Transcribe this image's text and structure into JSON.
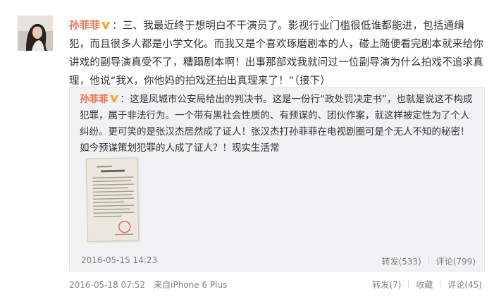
{
  "post": {
    "author": "孙菲菲",
    "badge_icon": "v-badge-icon",
    "text": "：三、我最近终于想明白不干演员了。影视行业门槛很低谁都能进，包括通缉犯，而且很多人都是小学文化。而我又是个喜欢琢磨剧本的人，碰上随便看完剧本就来给你讲戏的副导演真受不了，糟蹋剧本啊！出事那部戏我就问过一位副导演为什么拍戏不追求真理，他说“我X，你他妈的拍戏还拍出真理来了！”（接下）",
    "timestamp": "2016-05-18 07:52",
    "source": "来自iPhone 6 Plus",
    "repost_label": "转发(7)",
    "favorite_label": "收藏",
    "comment_label": "评论(45)"
  },
  "repost": {
    "author": "孙菲菲",
    "badge_icon": "v-badge-icon",
    "text": "：这是凤城市公安局给出的判决书。这是一份行“政处罚决定书”，也就是说这不构成犯罪，属于非法行为。一个带有黑社会性质的、有预谋的、团伙作案，就这样被定性为了个人纠纷。更可笑的是张汉杰居然成了证人！张汉杰打孙菲菲在电视剧圈可是个无人不知的秘密！如今预谋策划犯罪的人成了证人？！现实生活常",
    "timestamp": "2016-05-15 14:23",
    "repost_label": "转发(533)",
    "comment_label": "评论(799)"
  },
  "colors": {
    "author": "#eb7350",
    "badge": "#f5a623",
    "meta": "#808080",
    "repost_bg": "#f2f2f5"
  }
}
